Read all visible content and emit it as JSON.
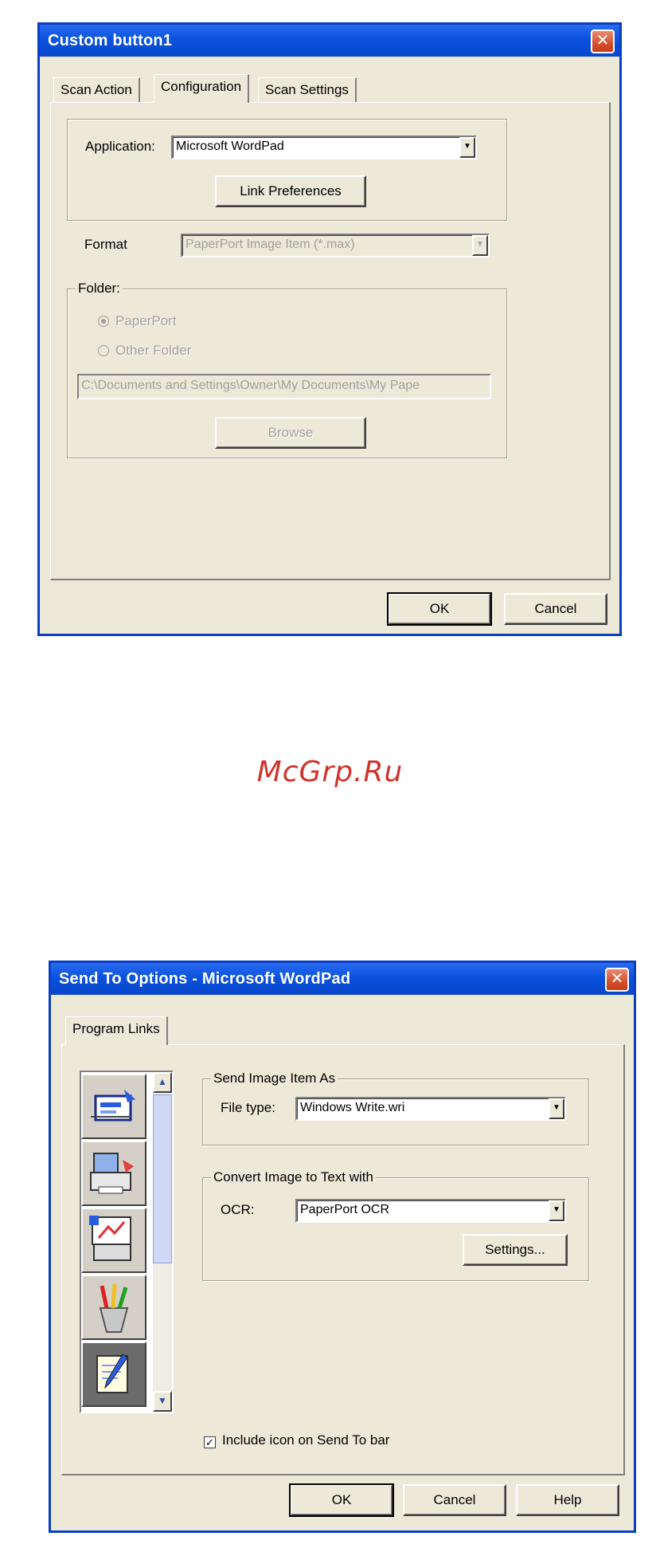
{
  "watermark": "McGrp.Ru",
  "dialog1": {
    "title": "Custom button1",
    "close_glyph": "✕",
    "tabs": [
      {
        "label": "Scan Action",
        "active": false
      },
      {
        "label": "Configuration",
        "active": true
      },
      {
        "label": "Scan Settings",
        "active": false
      }
    ],
    "application_label": "Application:",
    "application_value": "Microsoft WordPad",
    "link_preferences_label": "Link Preferences",
    "format_label": "Format",
    "format_value": "PaperPort Image Item (*.max)",
    "folder_legend": "Folder:",
    "radio_paperport": "PaperPort",
    "radio_other_folder": "Other Folder",
    "folder_path": "C:\\Documents and Settings\\Owner\\My Documents\\My Pape",
    "browse_label": "Browse",
    "ok_label": "OK",
    "cancel_label": "Cancel"
  },
  "dialog2": {
    "title": "Send To Options - Microsoft WordPad",
    "close_glyph": "✕",
    "tab": "Program Links",
    "icons": [
      "fax-icon",
      "printer-icon",
      "print-preview-icon",
      "paint-icon",
      "notepad-icon"
    ],
    "selected_icon_index": 4,
    "send_image_legend": "Send Image Item As",
    "file_type_label": "File type:",
    "file_type_value": "Windows Write.wri",
    "convert_legend": "Convert Image to Text with",
    "ocr_label": "OCR:",
    "ocr_value": "PaperPort OCR",
    "settings_label": "Settings...",
    "include_icon_label": "Include icon on Send To bar",
    "include_icon_checked": true,
    "ok_label": "OK",
    "cancel_label": "Cancel",
    "help_label": "Help"
  }
}
